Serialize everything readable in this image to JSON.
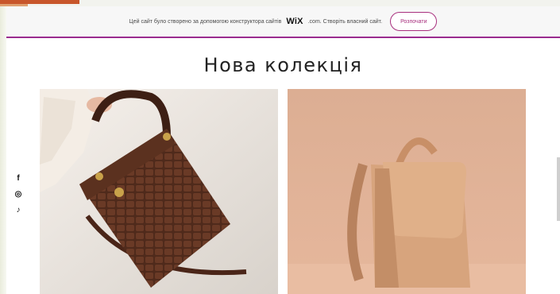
{
  "banner": {
    "text": "Цей сайт було створено за допомогою конструктора сайтів",
    "logo": "WiX",
    "logo_suffix": ".com. Створіть власний сайт.",
    "button_label": "Розпочати"
  },
  "page": {
    "title": "Нова колекція"
  },
  "social": {
    "icons": [
      "facebook-icon",
      "instagram-icon",
      "tiktok-icon"
    ],
    "glyphs": [
      "f",
      "◎",
      "♪"
    ]
  },
  "products": [
    {
      "image": "brown-croc-handbag"
    },
    {
      "image": "beige-backpack"
    }
  ],
  "colors": {
    "accent": "#9b2d8f",
    "button": "#a8307e"
  }
}
